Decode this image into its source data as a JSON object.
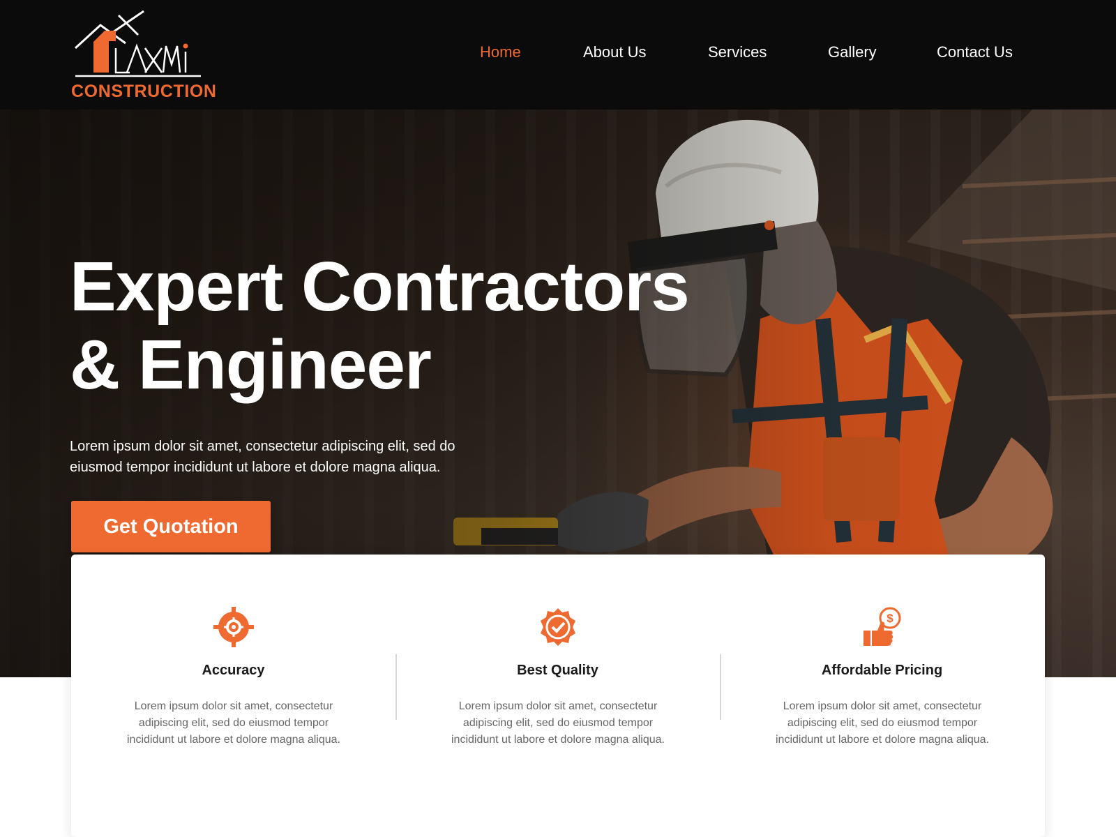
{
  "brand": {
    "logo_script": "LAXMI",
    "logo_word": "CONSTRUCTION",
    "accent_color": "#ef6a30"
  },
  "nav": {
    "items": [
      {
        "label": "Home",
        "active": true
      },
      {
        "label": "About Us",
        "active": false
      },
      {
        "label": "Services",
        "active": false
      },
      {
        "label": "Gallery",
        "active": false
      },
      {
        "label": "Contact Us",
        "active": false
      }
    ]
  },
  "hero": {
    "title_line1": "Expert Contractors",
    "title_line2": "& Engineer",
    "subtitle_line1": "Lorem ipsum dolor sit amet, consectetur adipiscing elit, sed do",
    "subtitle_line2": "eiusmod tempor incididunt ut labore et dolore magna aliqua.",
    "cta_label": "Get Quotation"
  },
  "features": [
    {
      "icon": "target-gear-icon",
      "title": "Accuracy",
      "text": "Lorem ipsum dolor sit amet, consectetur adipiscing elit, sed do eiusmod tempor incididunt ut labore et dolore magna aliqua."
    },
    {
      "icon": "quality-badge-icon",
      "title": "Best Quality",
      "text": "Lorem ipsum dolor sit amet, consectetur adipiscing elit, sed do eiusmod tempor incididunt ut labore et dolore magna aliqua."
    },
    {
      "icon": "thumbs-up-dollar-icon",
      "title": "Affordable Pricing",
      "text": "Lorem ipsum dolor sit amet, consectetur adipiscing elit, sed do eiusmod tempor incididunt ut labore et dolore magna aliqua."
    }
  ]
}
